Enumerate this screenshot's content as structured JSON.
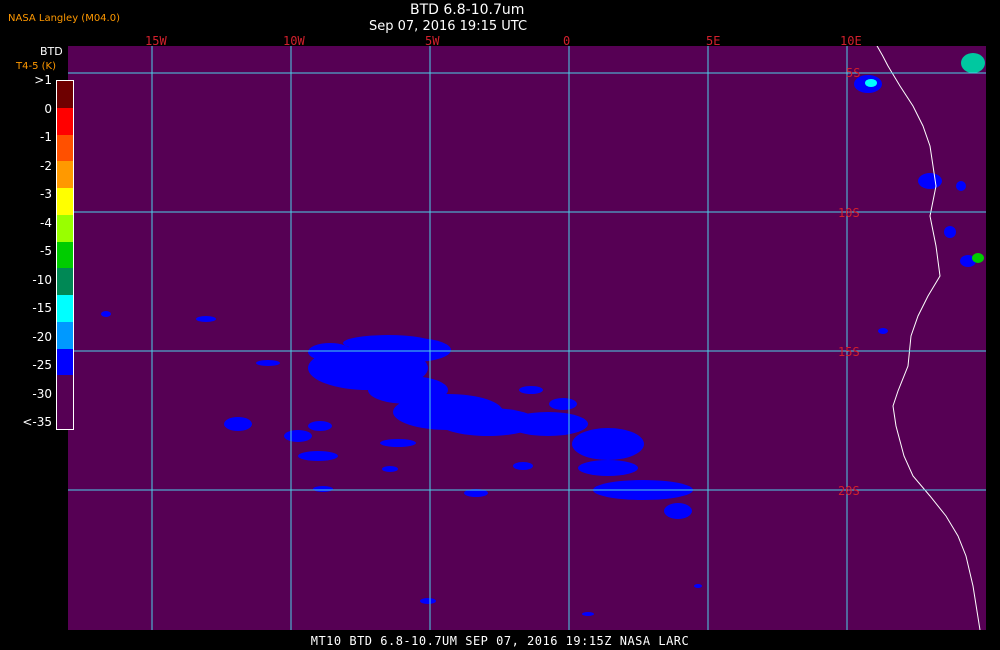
{
  "header": {
    "credit": "NASA Langley (M04.0)",
    "title": "BTD 6.8-10.7um",
    "subtitle": "Sep 07, 2016 19:15 UTC"
  },
  "legend": {
    "title": "BTD",
    "subtitle": "T4-5 (K)",
    "entries": [
      {
        "label": ">1",
        "color": "#6e0000"
      },
      {
        "label": "0",
        "color": "#ff0000"
      },
      {
        "label": "-1",
        "color": "#ff5000"
      },
      {
        "label": "-2",
        "color": "#ff9900"
      },
      {
        "label": "-3",
        "color": "#ffff00"
      },
      {
        "label": "-4",
        "color": "#99ff00"
      },
      {
        "label": "-5",
        "color": "#00cc00"
      },
      {
        "label": "-10",
        "color": "#008855"
      },
      {
        "label": "-15",
        "color": "#00ffff"
      },
      {
        "label": "-20",
        "color": "#0099ff"
      },
      {
        "label": "-25",
        "color": "#0000ff"
      },
      {
        "label": "-30",
        "color": "#560054"
      },
      {
        "label": "<-35",
        "color": "#560054"
      }
    ]
  },
  "map": {
    "background_color": "#560054",
    "grid_color": "#4cd0e8",
    "coastline_color": "#ffffff",
    "cloud_color": "#0000ff",
    "longitudes": [
      "15W",
      "10W",
      "5W",
      "0",
      "5E",
      "10E"
    ],
    "latitudes": [
      "5S",
      "10S",
      "15S",
      "20S"
    ]
  },
  "footer": {
    "text": "MT10  BTD 6.8-10.7UM   SEP 07, 2016 19:15Z   NASA LARC"
  }
}
